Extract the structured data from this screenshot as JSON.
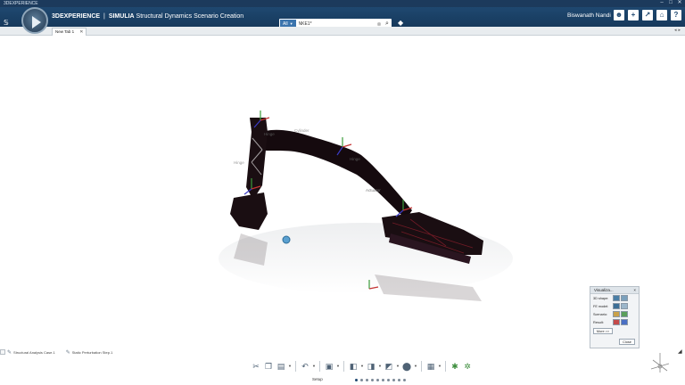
{
  "os": {
    "title": "3DEXPERIENCE",
    "controls": [
      "–",
      "□",
      "✕"
    ]
  },
  "header": {
    "brand": "3DEXPERIENCE",
    "separator": "|",
    "product": "SIMULIA",
    "app_name": "Structural Dynamics Scenario Creation",
    "search": {
      "scope": "All",
      "value": "NKE1*"
    },
    "user": "Biswanath Nandi",
    "icons": [
      "user-icon",
      "add-icon",
      "share-icon",
      "home-icon",
      "help-icon"
    ]
  },
  "tabs": [
    {
      "label": "New Tab 1",
      "active": true
    }
  ],
  "viewport": {
    "labels": [
      "Hinge",
      "Hinge",
      "Cylinder",
      "Hinge",
      "Actuator"
    ]
  },
  "visualization_panel": {
    "title": "Visualiza...",
    "rows": [
      {
        "label": "3D shape:"
      },
      {
        "label": "FE model:"
      },
      {
        "label": "Scenario:"
      },
      {
        "label": "Result:"
      }
    ],
    "more_label": "More >>",
    "close_label": "Close"
  },
  "breadcrumb": {
    "items": [
      "Structural Analysis Case.1",
      "Static Perturbation Step.1"
    ]
  },
  "toolbar": {
    "icons": [
      "cut-icon",
      "copy-icon",
      "paste-icon",
      "undo-icon",
      "insert-icon",
      "assembly-icon",
      "constraint-icon",
      "connection-icon",
      "mesh-icon",
      "chart-icon",
      "simulate-icon",
      "results-icon"
    ]
  },
  "section": {
    "label": "Setup",
    "dot_count": 10,
    "active_index": 0
  },
  "colors": {
    "topbar": "#1f4870",
    "model": "#1a0e12",
    "accent": "#3b74ad"
  }
}
